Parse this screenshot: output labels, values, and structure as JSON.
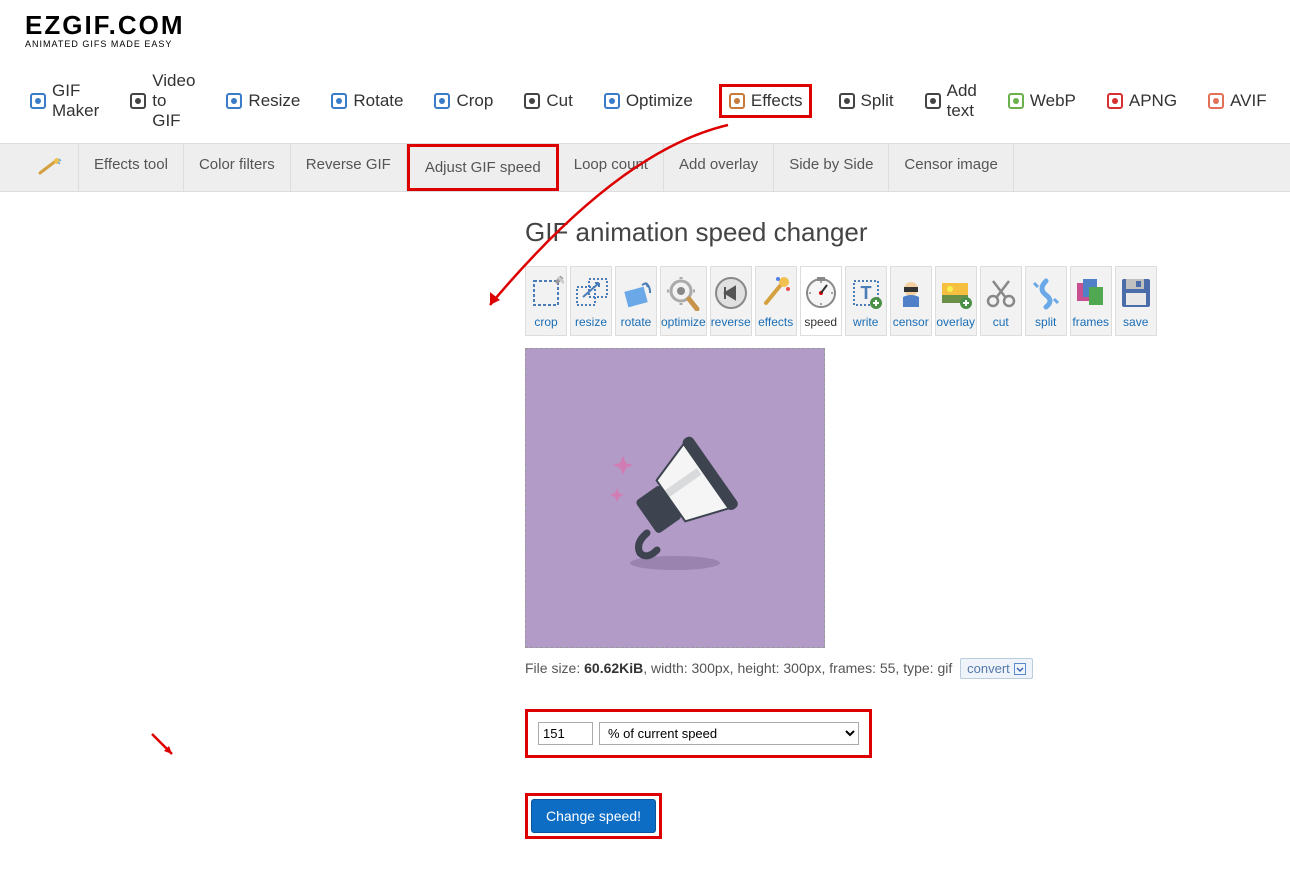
{
  "site": {
    "logo": "EZGIF.COM",
    "tagline": "ANIMATED GIFS MADE EASY"
  },
  "main_nav": [
    {
      "label": "GIF Maker",
      "icon": "gif-maker"
    },
    {
      "label": "Video to GIF",
      "icon": "video"
    },
    {
      "label": "Resize",
      "icon": "resize"
    },
    {
      "label": "Rotate",
      "icon": "rotate"
    },
    {
      "label": "Crop",
      "icon": "crop"
    },
    {
      "label": "Cut",
      "icon": "cut"
    },
    {
      "label": "Optimize",
      "icon": "optimize"
    },
    {
      "label": "Effects",
      "icon": "effects",
      "highlighted": true
    },
    {
      "label": "Split",
      "icon": "split"
    },
    {
      "label": "Add text",
      "icon": "text"
    },
    {
      "label": "WebP",
      "icon": "webp"
    },
    {
      "label": "APNG",
      "icon": "apng"
    },
    {
      "label": "AVIF",
      "icon": "avif"
    }
  ],
  "sub_nav": [
    {
      "label": "Effects tool"
    },
    {
      "label": "Color filters"
    },
    {
      "label": "Reverse GIF"
    },
    {
      "label": "Adjust GIF speed",
      "highlighted": true
    },
    {
      "label": "Loop count"
    },
    {
      "label": "Add overlay"
    },
    {
      "label": "Side by Side"
    },
    {
      "label": "Censor image"
    }
  ],
  "page": {
    "title": "GIF animation speed changer"
  },
  "toolbar": [
    {
      "label": "crop"
    },
    {
      "label": "resize"
    },
    {
      "label": "rotate"
    },
    {
      "label": "optimize"
    },
    {
      "label": "reverse"
    },
    {
      "label": "effects"
    },
    {
      "label": "speed",
      "active": true
    },
    {
      "label": "write"
    },
    {
      "label": "censor"
    },
    {
      "label": "overlay"
    },
    {
      "label": "cut"
    },
    {
      "label": "split"
    },
    {
      "label": "frames"
    },
    {
      "label": "save"
    }
  ],
  "file_info": {
    "prefix": "File size: ",
    "size": "60.62KiB",
    "rest": ", width: 300px, height: 300px, frames: 55, type: gif",
    "convert_label": "convert"
  },
  "controls": {
    "value": "151",
    "select_label": "% of current speed"
  },
  "submit": {
    "label": "Change speed!"
  }
}
